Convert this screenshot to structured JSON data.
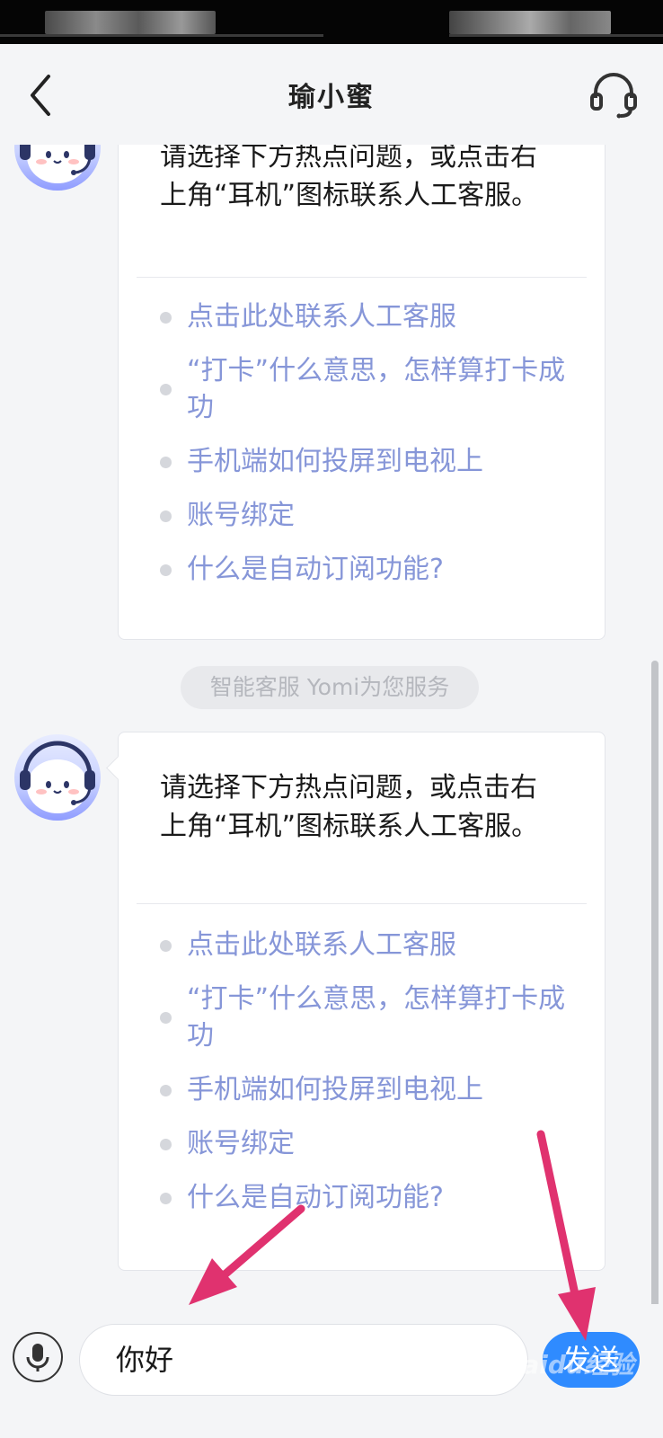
{
  "header": {
    "title": "瑜小蜜",
    "back_icon": "chevron-left-icon",
    "support_icon": "headset-icon"
  },
  "messages": [
    {
      "greeting": "请选择下方热点问题，或点击右上角“耳机”图标联系人工客服。",
      "faq": [
        "点击此处联系人工客服",
        "“打卡”什么意思，怎样算打卡成功",
        "手机端如何投屏到电视上",
        "账号绑定",
        "什么是自动订阅功能?"
      ]
    },
    {
      "greeting": "请选择下方热点问题，或点击右上角“耳机”图标联系人工客服。",
      "faq": [
        "点击此处联系人工客服",
        "“打卡”什么意思，怎样算打卡成功",
        "手机端如何投屏到电视上",
        "账号绑定",
        "什么是自动订阅功能?"
      ]
    }
  ],
  "system_notice": "智能客服 Yomi为您服务",
  "input": {
    "value": "你好",
    "mic_icon": "microphone-icon",
    "send_label": "发送"
  },
  "watermark": "Baidu经验",
  "colors": {
    "link": "#8696d8",
    "send_button": "#2f8bff",
    "annotation_arrow": "#e0326f"
  }
}
